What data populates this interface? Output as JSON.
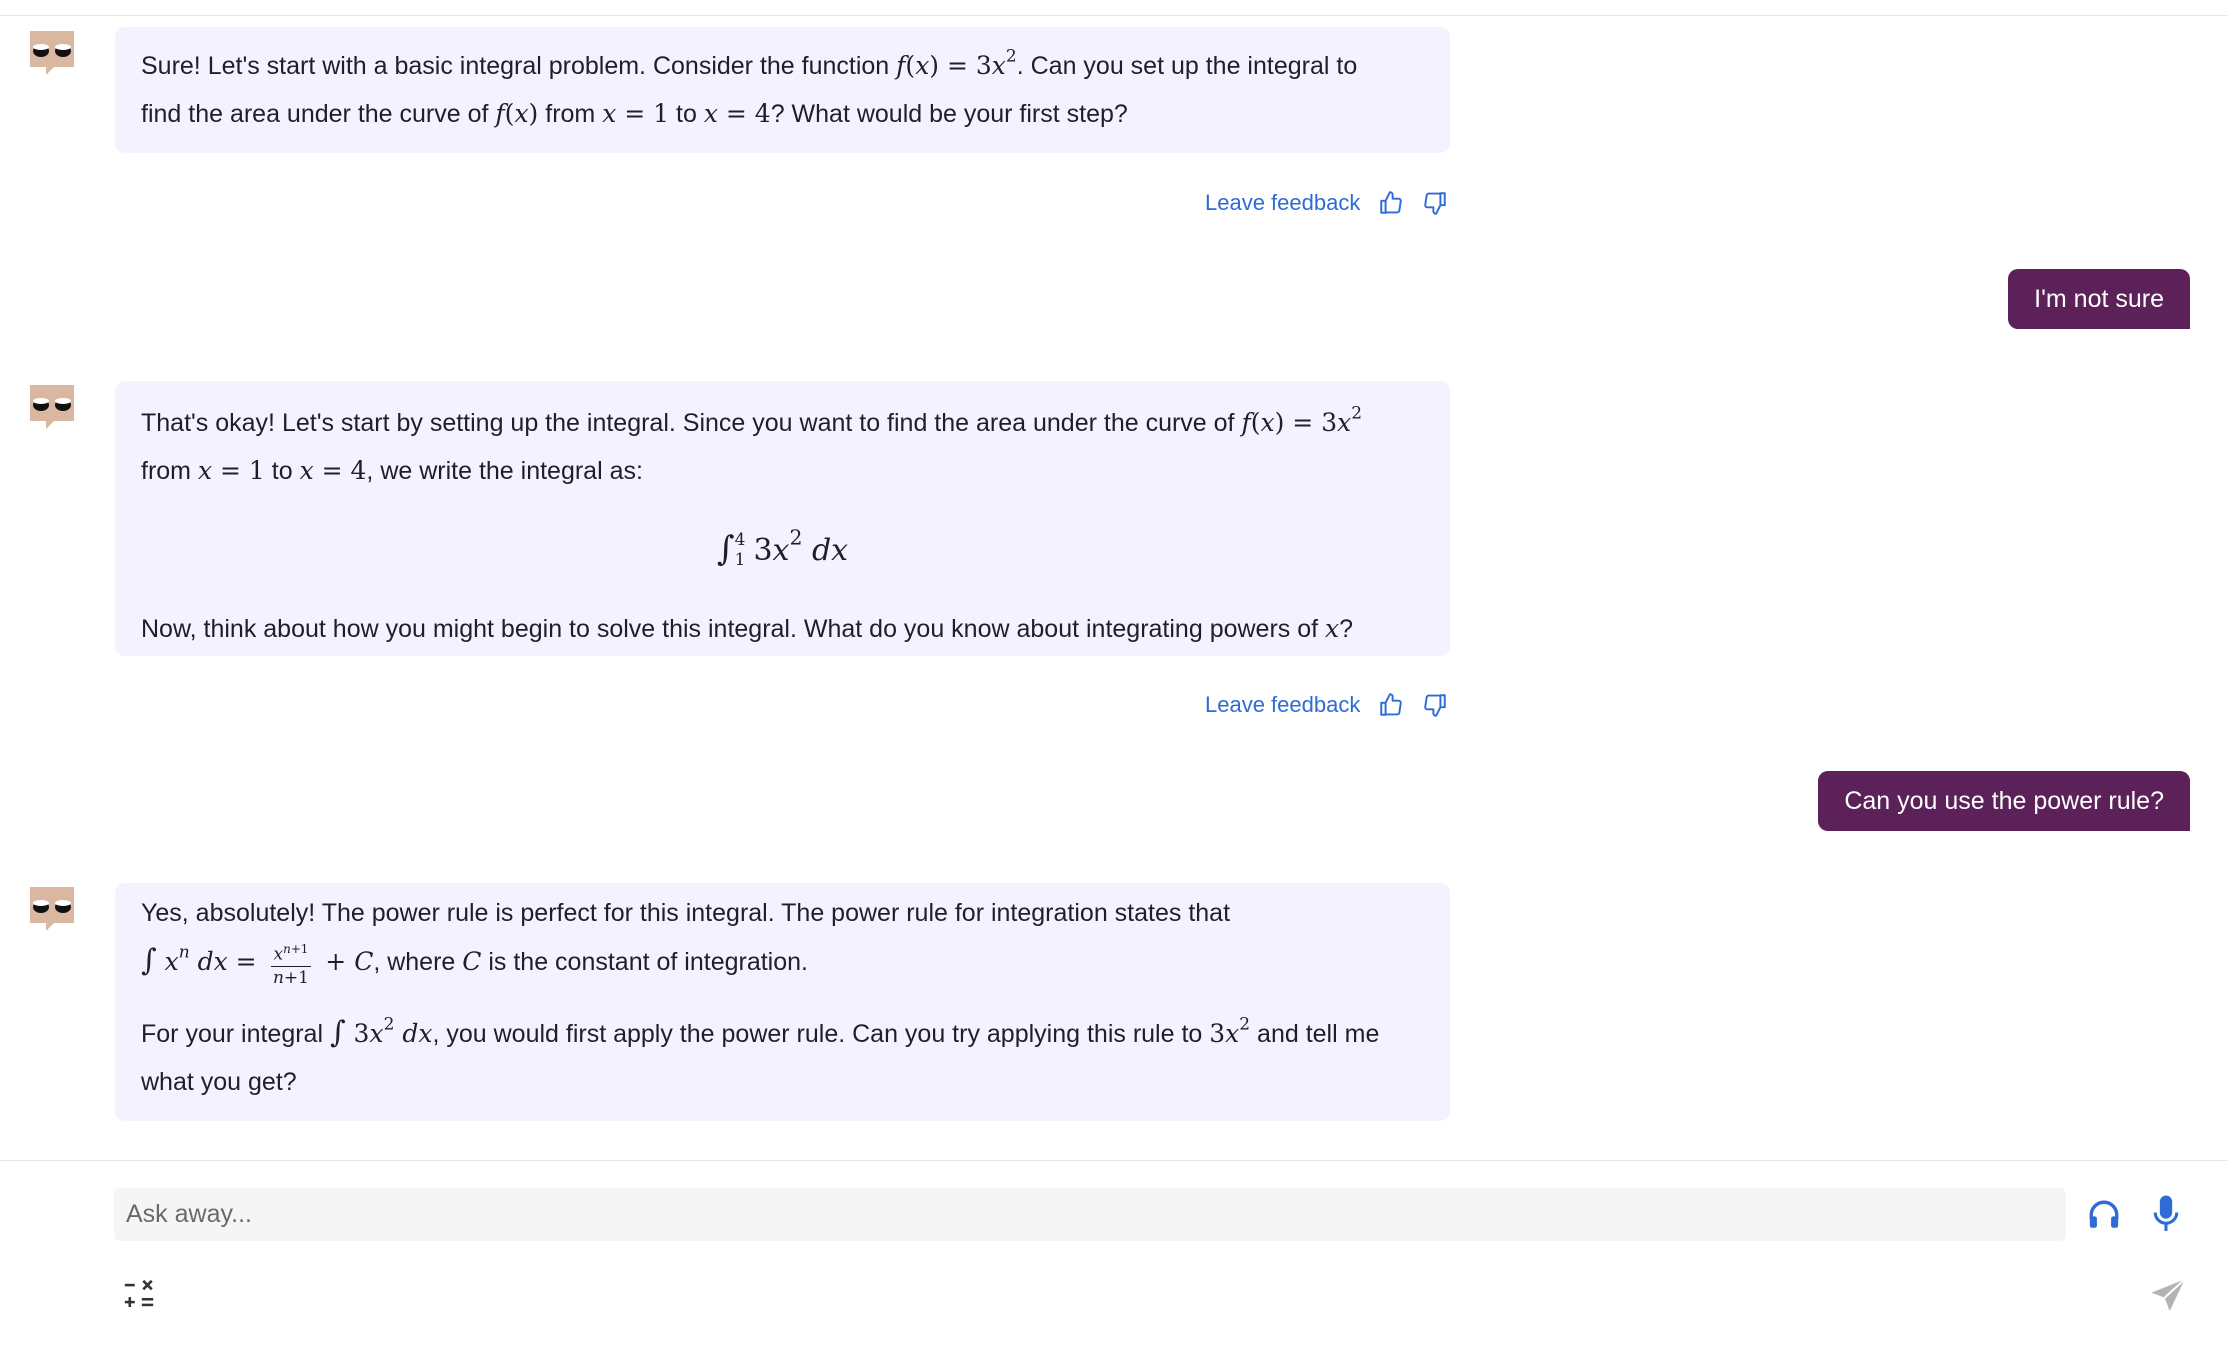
{
  "colors": {
    "assistant_bubble": "#f4f2fe",
    "user_bubble": "#5b2158",
    "link": "#2f6bd6",
    "icon_blue": "#2f6bd6"
  },
  "icons": {
    "avatar": "owl-avatar-icon",
    "thumbs_up": "thumbs-up-icon",
    "thumbs_down": "thumbs-down-icon",
    "audio": "headphones-icon",
    "mic": "microphone-icon",
    "math": "math-symbols-icon",
    "send": "send-icon"
  },
  "messages": [
    {
      "role": "assistant",
      "p1_a": "Sure! Let's start with a basic integral problem. Consider the function ",
      "p1_b": ". Can you set up the integral to",
      "p2_a": "find the area under the curve of ",
      "p2_b": " from ",
      "p2_c": " to ",
      "p2_d": "? What would be your first step?",
      "feedback": "Leave feedback"
    },
    {
      "role": "user",
      "text": "I'm not sure"
    },
    {
      "role": "assistant",
      "p1_a": "That's okay! Let's start by setting up the integral. Since you want to find the area under the curve of ",
      "p2_a": "from ",
      "p2_b": " to ",
      "p2_c": ", we write the integral as:",
      "p3": "Now, think about how you might begin to solve this integral. What do you know about integrating powers of ",
      "p3_end": "?",
      "feedback": "Leave feedback"
    },
    {
      "role": "user",
      "text": "Can you use the power rule?"
    },
    {
      "role": "assistant",
      "p1": "Yes, absolutely! The power rule is perfect for this integral. The power rule for integration states that",
      "p2_a": ", where ",
      "p2_b": " is the constant of integration.",
      "p3_a": "For your integral ",
      "p3_b": ", you would first apply the power rule. Can you try applying this rule to ",
      "p3_c": " and tell me",
      "p4": "what you get?"
    }
  ],
  "composer": {
    "placeholder": "Ask away..."
  }
}
